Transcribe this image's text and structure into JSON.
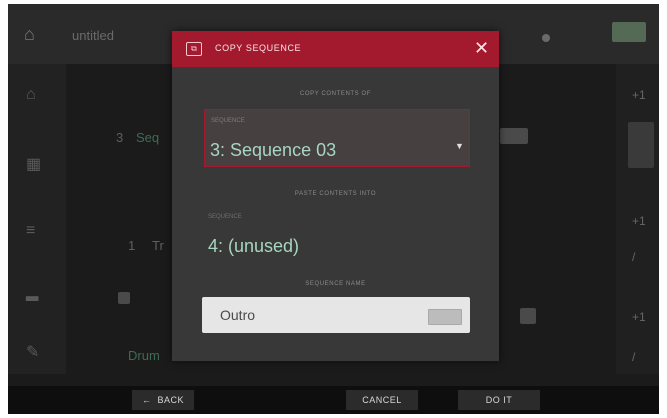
{
  "background": {
    "project_title": "untitled",
    "rows": [
      "3",
      "Seq",
      "1",
      "Tr",
      "Drum"
    ],
    "right_marks": [
      "+1",
      "/",
      "+1",
      "/",
      "+1",
      "/"
    ]
  },
  "dialog": {
    "title": "COPY SEQUENCE",
    "close_icon": "close-icon",
    "source_label": "COPY CONTENTS OF",
    "source_sublabel": "SEQUENCE",
    "source_value": "3: Sequence 03",
    "target_label": "PASTE CONTENTS INTO",
    "target_sublabel": "SEQUENCE",
    "target_value": "4: (unused)",
    "name_label": "SEQUENCE NAME",
    "name_value": "Outro",
    "accent_color": "#a3192d",
    "value_color": "#a7d6c2"
  },
  "footer": {
    "back_label": "BACK",
    "back_icon": "arrow-left-icon",
    "cancel_label": "CANCEL",
    "doit_label": "DO IT"
  }
}
